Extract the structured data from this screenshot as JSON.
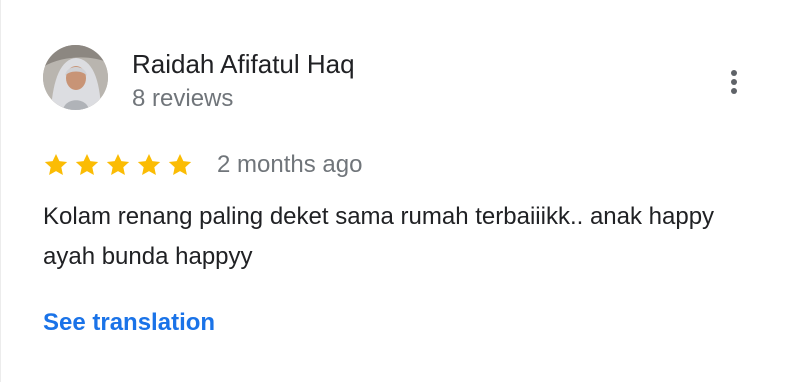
{
  "review": {
    "author_name": "Raidah Afifatul Haq",
    "review_count": "8 reviews",
    "rating": 5,
    "rating_max": 5,
    "date": "2 months ago",
    "text": "Kolam renang paling deket sama rumah terbaiiikk.. anak happy ayah bunda happyy",
    "translate_label": "See translation",
    "avatar_icon": "user-avatar-photo",
    "more_icon": "more-vert-icon",
    "star_icon": "star-icon"
  },
  "colors": {
    "star": "#fbbc04",
    "link": "#1a73e8",
    "primary_text": "#202124",
    "secondary_text": "#70757a",
    "icon": "#5f6368"
  }
}
